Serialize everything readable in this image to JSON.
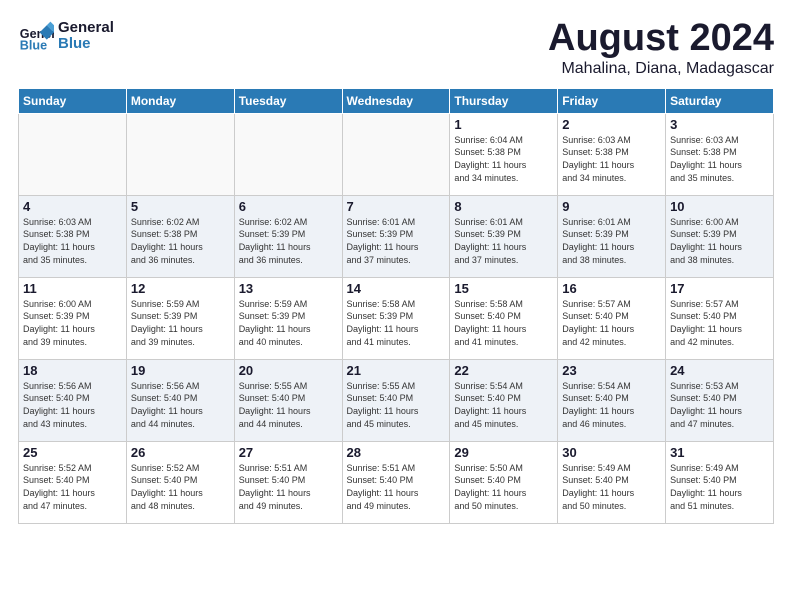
{
  "logo": {
    "text_general": "General",
    "text_blue": "Blue"
  },
  "title": {
    "month_year": "August 2024",
    "location": "Mahalina, Diana, Madagascar"
  },
  "headers": [
    "Sunday",
    "Monday",
    "Tuesday",
    "Wednesday",
    "Thursday",
    "Friday",
    "Saturday"
  ],
  "weeks": [
    [
      {
        "day": "",
        "info": ""
      },
      {
        "day": "",
        "info": ""
      },
      {
        "day": "",
        "info": ""
      },
      {
        "day": "",
        "info": ""
      },
      {
        "day": "1",
        "info": "Sunrise: 6:04 AM\nSunset: 5:38 PM\nDaylight: 11 hours\nand 34 minutes."
      },
      {
        "day": "2",
        "info": "Sunrise: 6:03 AM\nSunset: 5:38 PM\nDaylight: 11 hours\nand 34 minutes."
      },
      {
        "day": "3",
        "info": "Sunrise: 6:03 AM\nSunset: 5:38 PM\nDaylight: 11 hours\nand 35 minutes."
      }
    ],
    [
      {
        "day": "4",
        "info": "Sunrise: 6:03 AM\nSunset: 5:38 PM\nDaylight: 11 hours\nand 35 minutes."
      },
      {
        "day": "5",
        "info": "Sunrise: 6:02 AM\nSunset: 5:38 PM\nDaylight: 11 hours\nand 36 minutes."
      },
      {
        "day": "6",
        "info": "Sunrise: 6:02 AM\nSunset: 5:39 PM\nDaylight: 11 hours\nand 36 minutes."
      },
      {
        "day": "7",
        "info": "Sunrise: 6:01 AM\nSunset: 5:39 PM\nDaylight: 11 hours\nand 37 minutes."
      },
      {
        "day": "8",
        "info": "Sunrise: 6:01 AM\nSunset: 5:39 PM\nDaylight: 11 hours\nand 37 minutes."
      },
      {
        "day": "9",
        "info": "Sunrise: 6:01 AM\nSunset: 5:39 PM\nDaylight: 11 hours\nand 38 minutes."
      },
      {
        "day": "10",
        "info": "Sunrise: 6:00 AM\nSunset: 5:39 PM\nDaylight: 11 hours\nand 38 minutes."
      }
    ],
    [
      {
        "day": "11",
        "info": "Sunrise: 6:00 AM\nSunset: 5:39 PM\nDaylight: 11 hours\nand 39 minutes."
      },
      {
        "day": "12",
        "info": "Sunrise: 5:59 AM\nSunset: 5:39 PM\nDaylight: 11 hours\nand 39 minutes."
      },
      {
        "day": "13",
        "info": "Sunrise: 5:59 AM\nSunset: 5:39 PM\nDaylight: 11 hours\nand 40 minutes."
      },
      {
        "day": "14",
        "info": "Sunrise: 5:58 AM\nSunset: 5:39 PM\nDaylight: 11 hours\nand 41 minutes."
      },
      {
        "day": "15",
        "info": "Sunrise: 5:58 AM\nSunset: 5:40 PM\nDaylight: 11 hours\nand 41 minutes."
      },
      {
        "day": "16",
        "info": "Sunrise: 5:57 AM\nSunset: 5:40 PM\nDaylight: 11 hours\nand 42 minutes."
      },
      {
        "day": "17",
        "info": "Sunrise: 5:57 AM\nSunset: 5:40 PM\nDaylight: 11 hours\nand 42 minutes."
      }
    ],
    [
      {
        "day": "18",
        "info": "Sunrise: 5:56 AM\nSunset: 5:40 PM\nDaylight: 11 hours\nand 43 minutes."
      },
      {
        "day": "19",
        "info": "Sunrise: 5:56 AM\nSunset: 5:40 PM\nDaylight: 11 hours\nand 44 minutes."
      },
      {
        "day": "20",
        "info": "Sunrise: 5:55 AM\nSunset: 5:40 PM\nDaylight: 11 hours\nand 44 minutes."
      },
      {
        "day": "21",
        "info": "Sunrise: 5:55 AM\nSunset: 5:40 PM\nDaylight: 11 hours\nand 45 minutes."
      },
      {
        "day": "22",
        "info": "Sunrise: 5:54 AM\nSunset: 5:40 PM\nDaylight: 11 hours\nand 45 minutes."
      },
      {
        "day": "23",
        "info": "Sunrise: 5:54 AM\nSunset: 5:40 PM\nDaylight: 11 hours\nand 46 minutes."
      },
      {
        "day": "24",
        "info": "Sunrise: 5:53 AM\nSunset: 5:40 PM\nDaylight: 11 hours\nand 47 minutes."
      }
    ],
    [
      {
        "day": "25",
        "info": "Sunrise: 5:52 AM\nSunset: 5:40 PM\nDaylight: 11 hours\nand 47 minutes."
      },
      {
        "day": "26",
        "info": "Sunrise: 5:52 AM\nSunset: 5:40 PM\nDaylight: 11 hours\nand 48 minutes."
      },
      {
        "day": "27",
        "info": "Sunrise: 5:51 AM\nSunset: 5:40 PM\nDaylight: 11 hours\nand 49 minutes."
      },
      {
        "day": "28",
        "info": "Sunrise: 5:51 AM\nSunset: 5:40 PM\nDaylight: 11 hours\nand 49 minutes."
      },
      {
        "day": "29",
        "info": "Sunrise: 5:50 AM\nSunset: 5:40 PM\nDaylight: 11 hours\nand 50 minutes."
      },
      {
        "day": "30",
        "info": "Sunrise: 5:49 AM\nSunset: 5:40 PM\nDaylight: 11 hours\nand 50 minutes."
      },
      {
        "day": "31",
        "info": "Sunrise: 5:49 AM\nSunset: 5:40 PM\nDaylight: 11 hours\nand 51 minutes."
      }
    ]
  ]
}
